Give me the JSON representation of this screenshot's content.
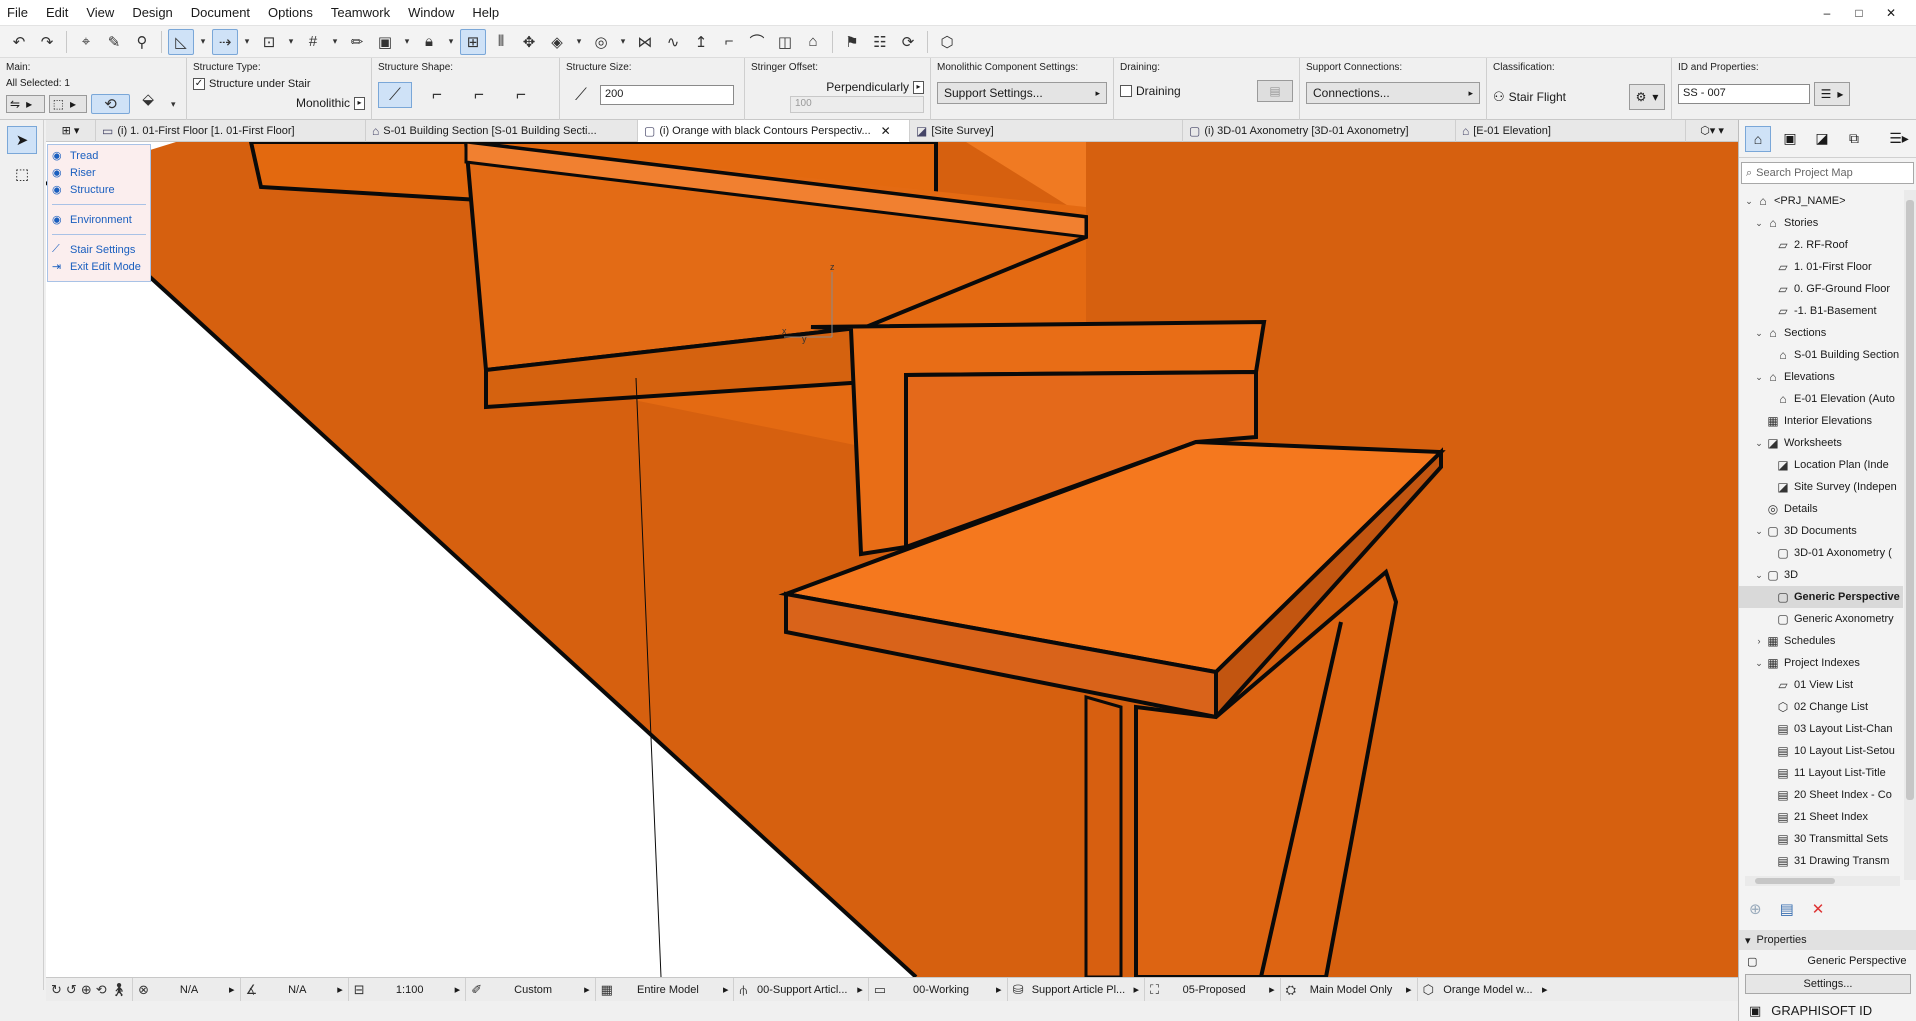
{
  "menu": [
    "File",
    "Edit",
    "View",
    "Design",
    "Document",
    "Options",
    "Teamwork",
    "Window",
    "Help"
  ],
  "window_controls": [
    "–",
    "□",
    "✕"
  ],
  "toolbar_icons": [
    "undo-icon",
    "redo-icon",
    "arrow-tools-icon",
    "pipette-icon",
    "magic-wand-icon",
    "guide-lines-icon",
    "snap-guides-icon",
    "trace-icon",
    "grid-snap-icon",
    "pencil-icon",
    "suspend-groups-icon",
    "lock-icon",
    "layout-icon",
    "align-icon",
    "rotate-icon",
    "mirror-icon",
    "drag-icon",
    "offset-icon",
    "fillet-icon",
    "explode-icon",
    "home-icon",
    "flag-icon",
    "favorites-icon",
    "3d-view-icon"
  ],
  "infobox": {
    "main": {
      "title": "Main:",
      "selection": "All Selected: 1"
    },
    "structure_type": {
      "title": "Structure Type:",
      "checkbox_label": "Structure under Stair",
      "checked": true,
      "value": "Monolithic"
    },
    "structure_shape": {
      "title": "Structure Shape:"
    },
    "structure_size": {
      "title": "Structure Size:",
      "value": "200"
    },
    "stringer_offset": {
      "title": "Stringer Offset:",
      "mode": "Perpendicularly",
      "value": "100"
    },
    "monolithic": {
      "title": "Monolithic Component Settings:",
      "button": "Support Settings..."
    },
    "draining": {
      "title": "Draining:",
      "checkbox_label": "Draining",
      "checked": false
    },
    "support": {
      "title": "Support Connections:",
      "button": "Connections..."
    },
    "classification": {
      "title": "Classification:",
      "value": "Stair Flight"
    },
    "id_props": {
      "title": "ID and Properties:",
      "value": "SS - 007"
    }
  },
  "tabs": [
    {
      "label": "(i) 1. 01-First Floor [1. 01-First Floor]",
      "icon": "▭",
      "active": false
    },
    {
      "label": "S-01 Building Section [S-01 Building Secti...",
      "icon": "⌂",
      "active": false
    },
    {
      "label": "(i) Orange with black Contours Perspectiv...",
      "icon": "▢",
      "active": true
    },
    {
      "label": "[Site Survey]",
      "icon": "◪",
      "active": false
    },
    {
      "label": "(i) 3D-01 Axonometry [3D-01 Axonometry]",
      "icon": "▢",
      "active": false
    },
    {
      "label": "[E-01 Elevation]",
      "icon": "⌂",
      "active": false
    }
  ],
  "edit_palette": {
    "items": [
      "Tread",
      "Riser",
      "Structure"
    ],
    "environment": "Environment",
    "stair_settings": "Stair Settings",
    "exit_edit": "Exit Edit Mode"
  },
  "gizmo": {
    "z": "z",
    "x": "x",
    "y": "y"
  },
  "statusbar": {
    "zoom1": "N/A",
    "zoom2": "N/A",
    "scale": "1:100",
    "pen_set": "Custom",
    "model": "Entire Model",
    "layer_combo": "00-Support Articl...",
    "dim": "00-Working",
    "renov": "Support Article Pl...",
    "reno_filter": "05-Proposed",
    "mvo": "Main Model Only",
    "view": "Orange Model w..."
  },
  "project_map": {
    "search_placeholder": "Search Project Map",
    "items": [
      {
        "label": "<PRJ_NAME>",
        "level": 0,
        "twisty": "⌄",
        "icon": "⌂"
      },
      {
        "label": "Stories",
        "level": 1,
        "twisty": "⌄",
        "icon": "⌂"
      },
      {
        "label": "2. RF-Roof",
        "level": 2,
        "twisty": "",
        "icon": "▱"
      },
      {
        "label": "1. 01-First Floor",
        "level": 2,
        "twisty": "",
        "icon": "▱"
      },
      {
        "label": "0. GF-Ground Floor",
        "level": 2,
        "twisty": "",
        "icon": "▱"
      },
      {
        "label": "-1. B1-Basement",
        "level": 2,
        "twisty": "",
        "icon": "▱"
      },
      {
        "label": "Sections",
        "level": 1,
        "twisty": "⌄",
        "icon": "⌂"
      },
      {
        "label": "S-01 Building Section",
        "level": 2,
        "twisty": "",
        "icon": "⌂"
      },
      {
        "label": "Elevations",
        "level": 1,
        "twisty": "⌄",
        "icon": "⌂"
      },
      {
        "label": "E-01 Elevation (Auto",
        "level": 2,
        "twisty": "",
        "icon": "⌂"
      },
      {
        "label": "Interior Elevations",
        "level": 1,
        "twisty": "",
        "icon": "▦"
      },
      {
        "label": "Worksheets",
        "level": 1,
        "twisty": "⌄",
        "icon": "◪"
      },
      {
        "label": "Location Plan (Inde",
        "level": 2,
        "twisty": "",
        "icon": "◪"
      },
      {
        "label": "Site Survey (Indepen",
        "level": 2,
        "twisty": "",
        "icon": "◪"
      },
      {
        "label": "Details",
        "level": 1,
        "twisty": "",
        "icon": "◎"
      },
      {
        "label": "3D Documents",
        "level": 1,
        "twisty": "⌄",
        "icon": "▢"
      },
      {
        "label": "3D-01 Axonometry (",
        "level": 2,
        "twisty": "",
        "icon": "▢"
      },
      {
        "label": "3D",
        "level": 1,
        "twisty": "⌄",
        "icon": "▢"
      },
      {
        "label": "Generic Perspective",
        "level": 2,
        "twisty": "",
        "icon": "▢",
        "selected": true
      },
      {
        "label": "Generic Axonometry",
        "level": 2,
        "twisty": "",
        "icon": "▢"
      },
      {
        "label": "Schedules",
        "level": 1,
        "twisty": "›",
        "icon": "▦"
      },
      {
        "label": "Project Indexes",
        "level": 1,
        "twisty": "⌄",
        "icon": "▦"
      },
      {
        "label": "01 View List",
        "level": 2,
        "twisty": "",
        "icon": "▱"
      },
      {
        "label": "02 Change List",
        "level": 2,
        "twisty": "",
        "icon": "⬡"
      },
      {
        "label": "03 Layout List-Chan",
        "level": 2,
        "twisty": "",
        "icon": "▤"
      },
      {
        "label": "10 Layout List-Setou",
        "level": 2,
        "twisty": "",
        "icon": "▤"
      },
      {
        "label": "11 Layout List-Title",
        "level": 2,
        "twisty": "",
        "icon": "▤"
      },
      {
        "label": "20 Sheet Index - Co",
        "level": 2,
        "twisty": "",
        "icon": "▤"
      },
      {
        "label": "21 Sheet Index",
        "level": 2,
        "twisty": "",
        "icon": "▤"
      },
      {
        "label": "30 Transmittal Sets",
        "level": 2,
        "twisty": "",
        "icon": "▤"
      },
      {
        "label": "31 Drawing Transm",
        "level": 2,
        "twisty": "",
        "icon": "▤"
      }
    ]
  },
  "properties": {
    "header": "Properties",
    "name": "Generic Perspective",
    "settings_button": "Settings..."
  },
  "graphisoft_id": "GRAPHISOFT ID",
  "colors": {
    "stair_orange": "#f0721e",
    "stair_dark": "#d45f12",
    "accent_blue": "#1a5fbf",
    "selection_blue": "#cfe2f7"
  }
}
